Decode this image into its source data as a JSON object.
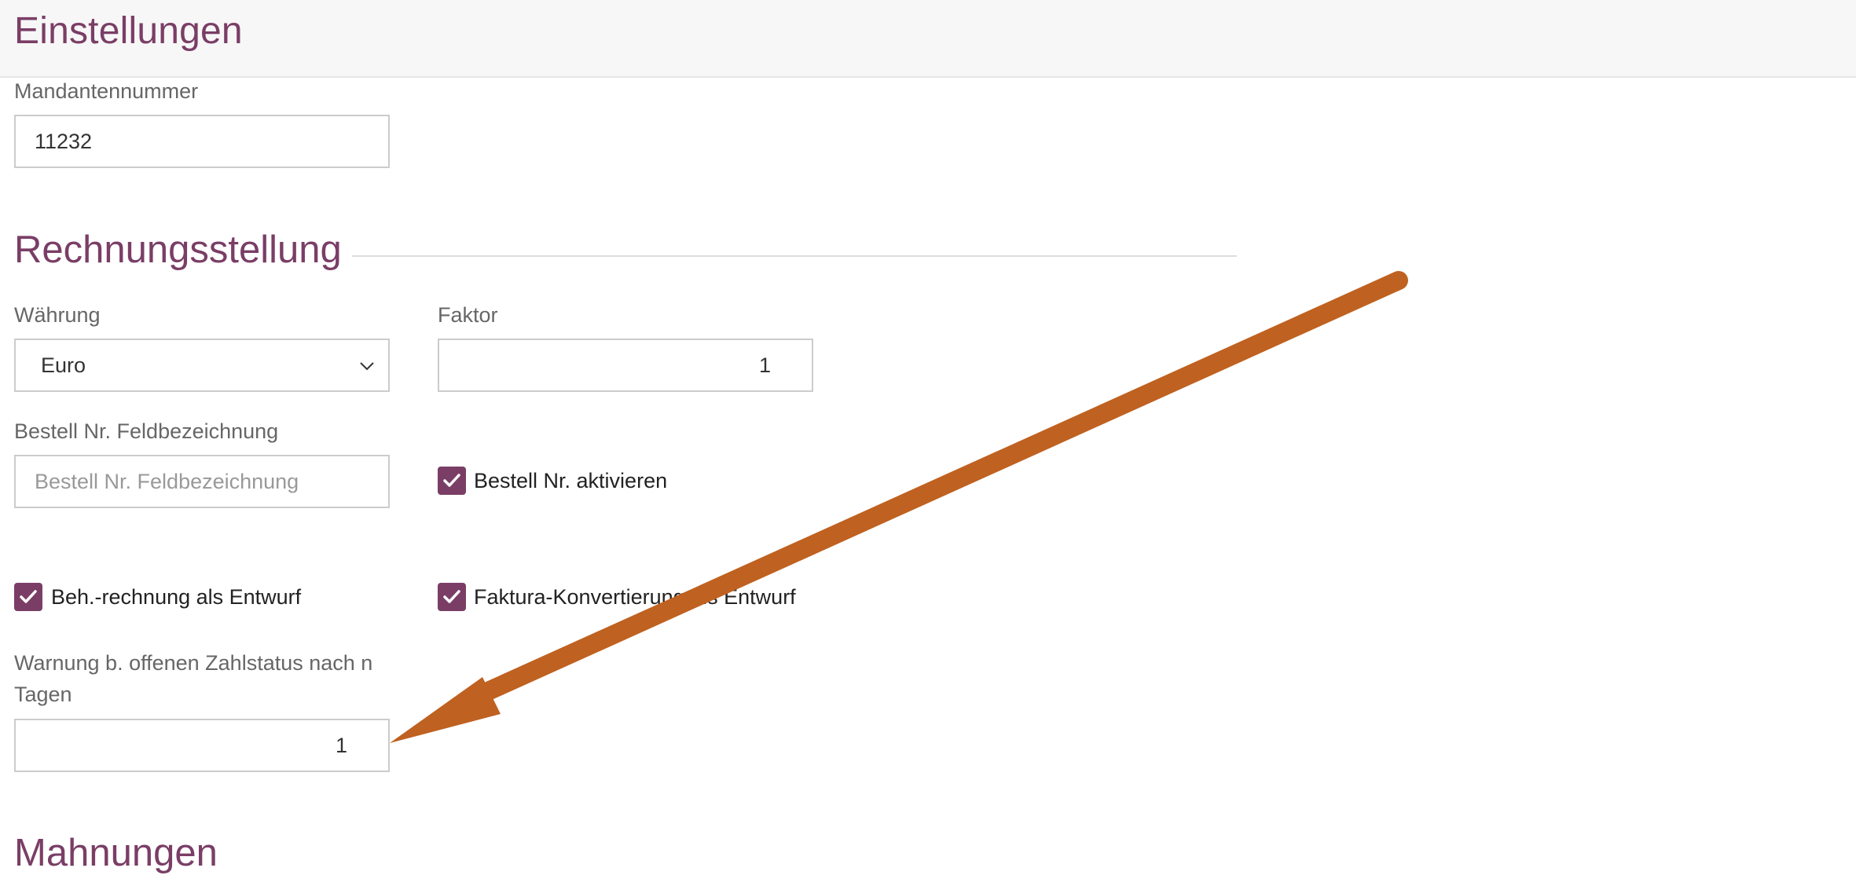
{
  "header": {
    "title": "Einstellungen"
  },
  "client": {
    "label": "Mandantennummer",
    "value": "11232"
  },
  "billing": {
    "section_title": "Rechnungsstellung",
    "currency": {
      "label": "Währung",
      "value": "Euro"
    },
    "factor": {
      "label": "Faktor",
      "value": "1"
    },
    "order_no_label": {
      "label": "Bestell Nr. Feldbezeichnung",
      "placeholder": "Bestell Nr. Feldbezeichnung"
    },
    "order_no_enable": {
      "label": "Bestell Nr. aktivieren",
      "checked": true
    },
    "treatment_draft": {
      "label": "Beh.-rechnung als Entwurf",
      "checked": true
    },
    "invoice_conversion_draft": {
      "label": "Faktura-Konvertierung als Entwurf",
      "checked": true
    },
    "warning_days": {
      "label_line1": "Warnung b. offenen Zahlstatus nach n",
      "label_line2": "Tagen",
      "value": "1"
    }
  },
  "next_section": {
    "title": "Mahnungen"
  },
  "annotation": {
    "color": "#bf6120"
  },
  "colors": {
    "accent": "#7a3e66",
    "header_bg": "#f7f7f7"
  }
}
